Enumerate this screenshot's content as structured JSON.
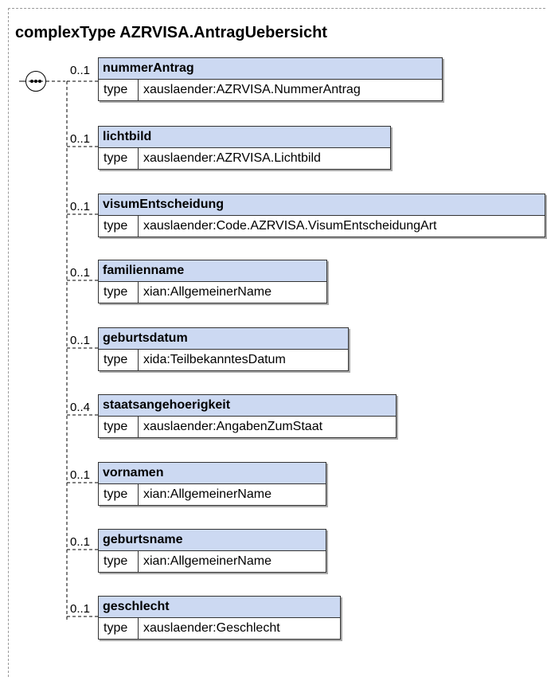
{
  "title": "complexType AZRVISA.AntragUebersicht",
  "type_key": "type",
  "elements": [
    {
      "name": "nummerAntrag",
      "type": "xauslaender:AZRVISA.NummerAntrag",
      "cardinality": "0..1"
    },
    {
      "name": "lichtbild",
      "type": "xauslaender:AZRVISA.Lichtbild",
      "cardinality": "0..1"
    },
    {
      "name": "visumEntscheidung",
      "type": "xauslaender:Code.AZRVISA.VisumEntscheidungArt",
      "cardinality": "0..1"
    },
    {
      "name": "familienname",
      "type": "xian:AllgemeinerName",
      "cardinality": "0..1"
    },
    {
      "name": "geburtsdatum",
      "type": "xida:TeilbekanntesDatum",
      "cardinality": "0..1"
    },
    {
      "name": "staatsangehoerigkeit",
      "type": "xauslaender:AngabenZumStaat",
      "cardinality": "0..4"
    },
    {
      "name": "vornamen",
      "type": "xian:AllgemeinerName",
      "cardinality": "0..1"
    },
    {
      "name": "geburtsname",
      "type": "xian:AllgemeinerName",
      "cardinality": "0..1"
    },
    {
      "name": "geschlecht",
      "type": "xauslaender:Geschlecht",
      "cardinality": "0..1"
    }
  ],
  "colors": {
    "header_fill": "#ccd9f2",
    "border": "#333333"
  }
}
